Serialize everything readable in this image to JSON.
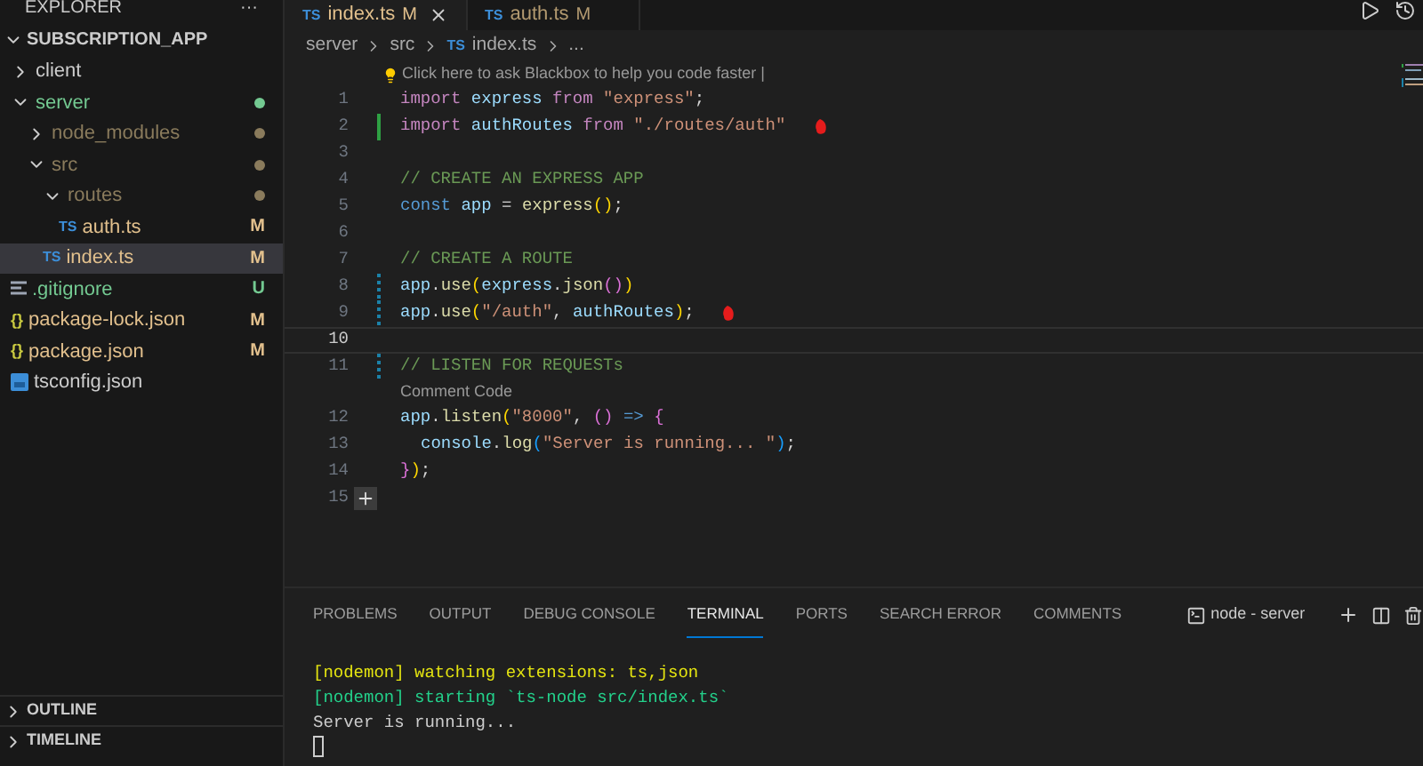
{
  "sidebar": {
    "title": "EXPLORER",
    "more": "···",
    "root": {
      "label": "SUBSCRIPTION_APP",
      "expanded": true,
      "children": [
        {
          "label": "client",
          "kind": "folder",
          "expanded": false,
          "selected": false
        },
        {
          "label": "server",
          "kind": "folder",
          "expanded": true,
          "selected": false,
          "color": "#73c991",
          "children": [
            {
              "label": "node_modules",
              "kind": "folder",
              "expanded": false,
              "selected": false,
              "color": "#8a7b5c"
            },
            {
              "label": "src",
              "kind": "folder",
              "expanded": true,
              "selected": false,
              "color": "#8a7b5c",
              "children": [
                {
                  "label": "routes",
                  "kind": "folder",
                  "expanded": true,
                  "selected": false,
                  "color": "#8a7b5c",
                  "children": [
                    {
                      "label": "auth.ts",
                      "kind": "ts",
                      "icon": "TS",
                      "selected": false,
                      "color": "#e2c08d",
                      "badge": "M"
                    }
                  ]
                },
                {
                  "label": "index.ts",
                  "kind": "ts",
                  "icon": "TS",
                  "selected": true,
                  "color": "#e2c08d",
                  "badge": "M"
                }
              ]
            }
          ]
        },
        {
          "label": ".gitignore",
          "kind": "text",
          "selected": false,
          "color": "#73c991",
          "badge": "U"
        },
        {
          "label": "package-lock.json",
          "kind": "json",
          "icon": "{}",
          "selected": false,
          "color": "#e2c08d",
          "badge": "M"
        },
        {
          "label": "package.json",
          "kind": "json",
          "icon": "{}",
          "selected": false,
          "color": "#e2c08d",
          "badge": "M"
        },
        {
          "label": "tsconfig.json",
          "kind": "tsconfig",
          "selected": false
        }
      ]
    },
    "sections": [
      {
        "label": "OUTLINE",
        "expanded": false
      },
      {
        "label": "TIMELINE",
        "expanded": false
      }
    ]
  },
  "tabs": [
    {
      "icon": "TS",
      "label": "index.ts",
      "badge": "M",
      "selected": true
    },
    {
      "icon": "TS",
      "label": "auth.ts",
      "badge": "M",
      "selected": false
    }
  ],
  "breadcrumb": [
    {
      "label": "server"
    },
    {
      "label": "src"
    },
    {
      "icon": "TS",
      "label": "index.ts"
    },
    {
      "label": "..."
    }
  ],
  "lines": [
    {
      "number": "1",
      "lens": "Click here to ask Blackbox to help you code faster |",
      "tokens": [
        {
          "kind": "keyword",
          "text": "import "
        },
        {
          "kind": "variable",
          "text": "express "
        },
        {
          "kind": "keyword",
          "text": "from "
        },
        {
          "kind": "string",
          "text": "\"express\""
        },
        {
          "kind": "plain",
          "text": ";"
        }
      ]
    },
    {
      "number": "2",
      "kind": "added",
      "ink": true,
      "tokens": [
        {
          "kind": "keyword",
          "text": "import "
        },
        {
          "kind": "variable",
          "text": "authRoutes "
        },
        {
          "kind": "keyword",
          "text": "from "
        },
        {
          "kind": "string",
          "text": "\"./routes/auth\""
        }
      ]
    },
    {
      "number": "3"
    },
    {
      "number": "4",
      "tokens": [
        {
          "kind": "comment",
          "text": "// CREATE AN EXPRESS APP"
        }
      ]
    },
    {
      "number": "5",
      "tokens": [
        {
          "kind": "storage",
          "text": "const "
        },
        {
          "kind": "variable",
          "text": "app "
        },
        {
          "kind": "plain",
          "text": "= "
        },
        {
          "kind": "function",
          "text": "express"
        },
        {
          "kind": "bracket1",
          "text": "()"
        },
        {
          "kind": "plain",
          "text": ";"
        }
      ]
    },
    {
      "number": "6"
    },
    {
      "number": "7",
      "tokens": [
        {
          "kind": "comment",
          "text": "// CREATE A ROUTE"
        }
      ]
    },
    {
      "number": "8",
      "kind": "modified",
      "tokens": [
        {
          "kind": "variable",
          "text": "app"
        },
        {
          "kind": "plain",
          "text": "."
        },
        {
          "kind": "function",
          "text": "use"
        },
        {
          "kind": "bracket1",
          "text": "("
        },
        {
          "kind": "variable",
          "text": "express"
        },
        {
          "kind": "plain",
          "text": "."
        },
        {
          "kind": "function",
          "text": "json"
        },
        {
          "kind": "bracket2",
          "text": "()"
        },
        {
          "kind": "bracket1",
          "text": ")"
        }
      ]
    },
    {
      "number": "9",
      "kind": "modified",
      "ink": true,
      "tokens": [
        {
          "kind": "variable",
          "text": "app"
        },
        {
          "kind": "plain",
          "text": "."
        },
        {
          "kind": "function",
          "text": "use"
        },
        {
          "kind": "bracket1",
          "text": "("
        },
        {
          "kind": "string",
          "text": "\"/auth\""
        },
        {
          "kind": "plain",
          "text": ", "
        },
        {
          "kind": "variable",
          "text": "authRoutes"
        },
        {
          "kind": "bracket1",
          "text": ")"
        },
        {
          "kind": "plain",
          "text": ";"
        }
      ]
    },
    {
      "number": "10",
      "current": true
    },
    {
      "number": "11",
      "kind": "modified",
      "tokens": [
        {
          "kind": "comment",
          "text": "// LISTEN FOR REQUESTs"
        }
      ]
    },
    {
      "number": "12",
      "lens": "Comment Code",
      "tokens": [
        {
          "kind": "variable",
          "text": "app"
        },
        {
          "kind": "plain",
          "text": "."
        },
        {
          "kind": "function",
          "text": "listen"
        },
        {
          "kind": "bracket1",
          "text": "("
        },
        {
          "kind": "string",
          "text": "\"8000\""
        },
        {
          "kind": "plain",
          "text": ", "
        },
        {
          "kind": "bracket2",
          "text": "() "
        },
        {
          "kind": "storage",
          "text": "=> "
        },
        {
          "kind": "bracket2",
          "text": "{"
        }
      ]
    },
    {
      "number": "13",
      "indent": true,
      "tokens": [
        {
          "kind": "variable",
          "text": "console"
        },
        {
          "kind": "plain",
          "text": "."
        },
        {
          "kind": "function",
          "text": "log"
        },
        {
          "kind": "bracket3",
          "text": "("
        },
        {
          "kind": "string",
          "text": "\"Server is running... \""
        },
        {
          "kind": "bracket3",
          "text": ")"
        },
        {
          "kind": "plain",
          "text": ";"
        }
      ]
    },
    {
      "number": "14",
      "tokens": [
        {
          "kind": "bracket2",
          "text": "}"
        },
        {
          "kind": "bracket1",
          "text": ")"
        },
        {
          "kind": "plain",
          "text": ";"
        }
      ]
    },
    {
      "number": "15",
      "comment_button": true
    }
  ],
  "panel": {
    "tabs": [
      {
        "label": "PROBLEMS",
        "selected": false
      },
      {
        "label": "OUTPUT",
        "selected": false
      },
      {
        "label": "DEBUG CONSOLE",
        "selected": false
      },
      {
        "label": "TERMINAL",
        "selected": true
      },
      {
        "label": "PORTS",
        "selected": false
      },
      {
        "label": "SEARCH ERROR",
        "selected": false
      },
      {
        "label": "COMMENTS",
        "selected": false
      }
    ],
    "terminal_name": "node - server",
    "output": [
      {
        "kind": "warn",
        "text": "[nodemon] watching extensions: ts,json"
      },
      {
        "kind": "info",
        "text": "[nodemon] starting `ts-node src/index.ts`"
      },
      {
        "kind": "plain",
        "text": "Server is running..."
      }
    ]
  }
}
